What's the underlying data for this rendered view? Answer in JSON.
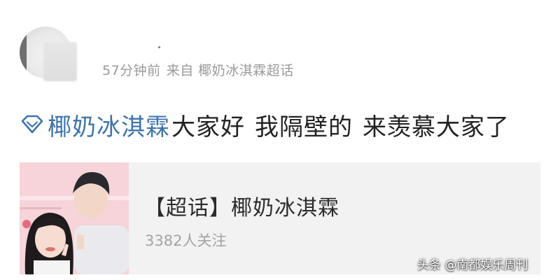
{
  "post": {
    "meta": {
      "time_ago": "57分钟前",
      "source": "来自 椰奶冰淇霖超话"
    },
    "topic_icon": "diamond-icon",
    "topic_link": "椰奶冰淇霖",
    "text_parts": [
      "大家好",
      "我隔壁的",
      "来羡慕大家了"
    ]
  },
  "card": {
    "title": "【超话】椰奶冰淇霖",
    "followers": "3382人关注"
  },
  "watermark": "头条 @南都娱乐周刊",
  "colors": {
    "topic_link": "#3f73a8",
    "meta_text": "#9a9a9a",
    "card_bg": "#f2f2f2",
    "body_text": "#222222"
  }
}
